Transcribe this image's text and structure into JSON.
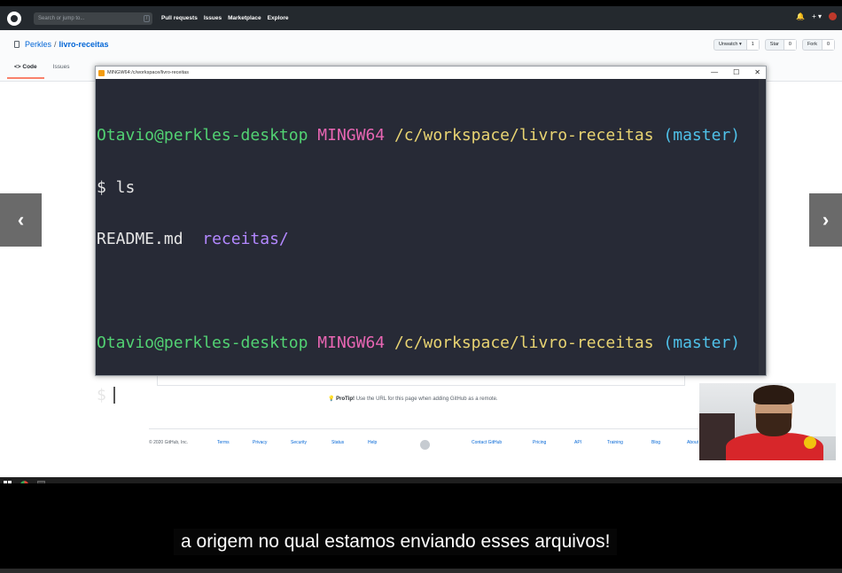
{
  "github": {
    "search_placeholder": "Search or jump to...",
    "search_shortcut": "/",
    "nav": [
      "Pull requests",
      "Issues",
      "Marketplace",
      "Explore"
    ],
    "right_controls": [
      "+ ▾"
    ],
    "repo_owner": "Perkles",
    "repo_sep": "/",
    "repo_name": "livro-receitas",
    "actions": {
      "watch_label": "Unwatch ▾",
      "watch_count": "1",
      "star_label": "Star",
      "star_count": "0",
      "fork_label": "Fork",
      "fork_count": "0"
    },
    "tabs": [
      {
        "label": "<> Code",
        "active": true
      },
      {
        "label": "Issues",
        "active": false
      }
    ],
    "protip_bold": "ProTip!",
    "protip_text": "Use the URL for this page when adding GitHub as a remote.",
    "footer": [
      "© 2020 GitHub, Inc.",
      "Terms",
      "Privacy",
      "Security",
      "Status",
      "Help",
      "Contact GitHub",
      "Pricing",
      "API",
      "Training",
      "Blog",
      "About"
    ]
  },
  "terminal": {
    "title": "MINGW64:/c/workspace/livro-receitas",
    "controls": [
      "—",
      "☐",
      "✕"
    ],
    "prompt_user": "Otavio@perkles-desktop",
    "prompt_env": "MINGW64",
    "prompt_path": "/c/workspace/livro-receitas",
    "prompt_branch": "(master)",
    "cmd1": "$ ls",
    "ls_file": "README.md",
    "ls_dir": "receitas/",
    "prompt2_symbol": "$"
  },
  "video": {
    "prev_arrow": "‹",
    "next_arrow": "›",
    "subtitle": "a origem no qual estamos enviando esses arquivos!"
  },
  "colors": {
    "terminal_bg": "#272a36",
    "prompt_user": "#52d273",
    "prompt_env": "#e866b3",
    "prompt_path": "#e9d472",
    "prompt_branch": "#4fc1e9",
    "directory": "#b388ff"
  }
}
